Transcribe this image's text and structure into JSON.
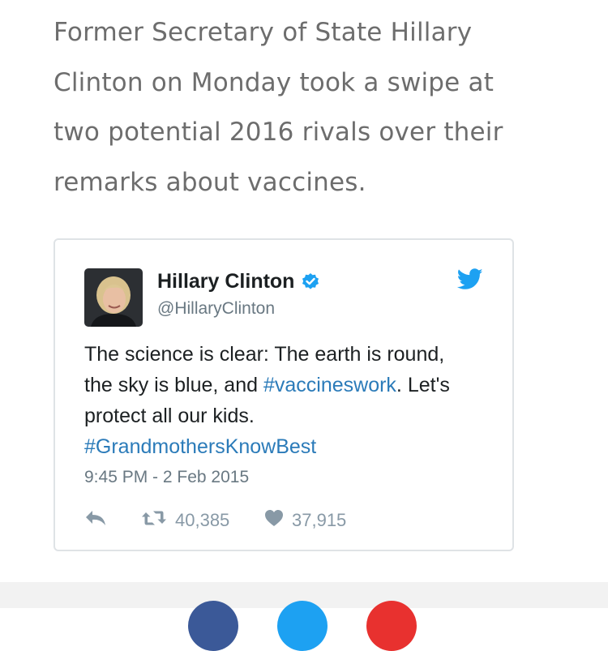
{
  "article": {
    "paragraph": "Former Secretary of State Hillary Clinton on Monday took a swipe at two potential 2016 rivals over their remarks about vaccines."
  },
  "tweet": {
    "author_name": "Hillary Clinton",
    "author_handle": "@HillaryClinton",
    "text_part1": "The science is clear: The earth is round, the sky is blue, and ",
    "hashtag1": "#vaccineswork",
    "text_part2": ". Let's protect all our kids. ",
    "hashtag2": "#GrandmothersKnowBest",
    "timestamp": "9:45 PM - 2 Feb 2015",
    "retweet_count": "40,385",
    "like_count": "37,915",
    "icons": {
      "reply": "reply-icon",
      "retweet": "retweet-icon",
      "like": "heart-icon",
      "verified": "verified-badge-icon",
      "brand": "twitter-bird-icon"
    }
  },
  "colors": {
    "hashtag": "#2b7bb9",
    "twitter_blue": "#1da1f2",
    "share_facebook": "#3b5998",
    "share_twitter": "#1da1f2",
    "share_red": "#e8312f"
  }
}
